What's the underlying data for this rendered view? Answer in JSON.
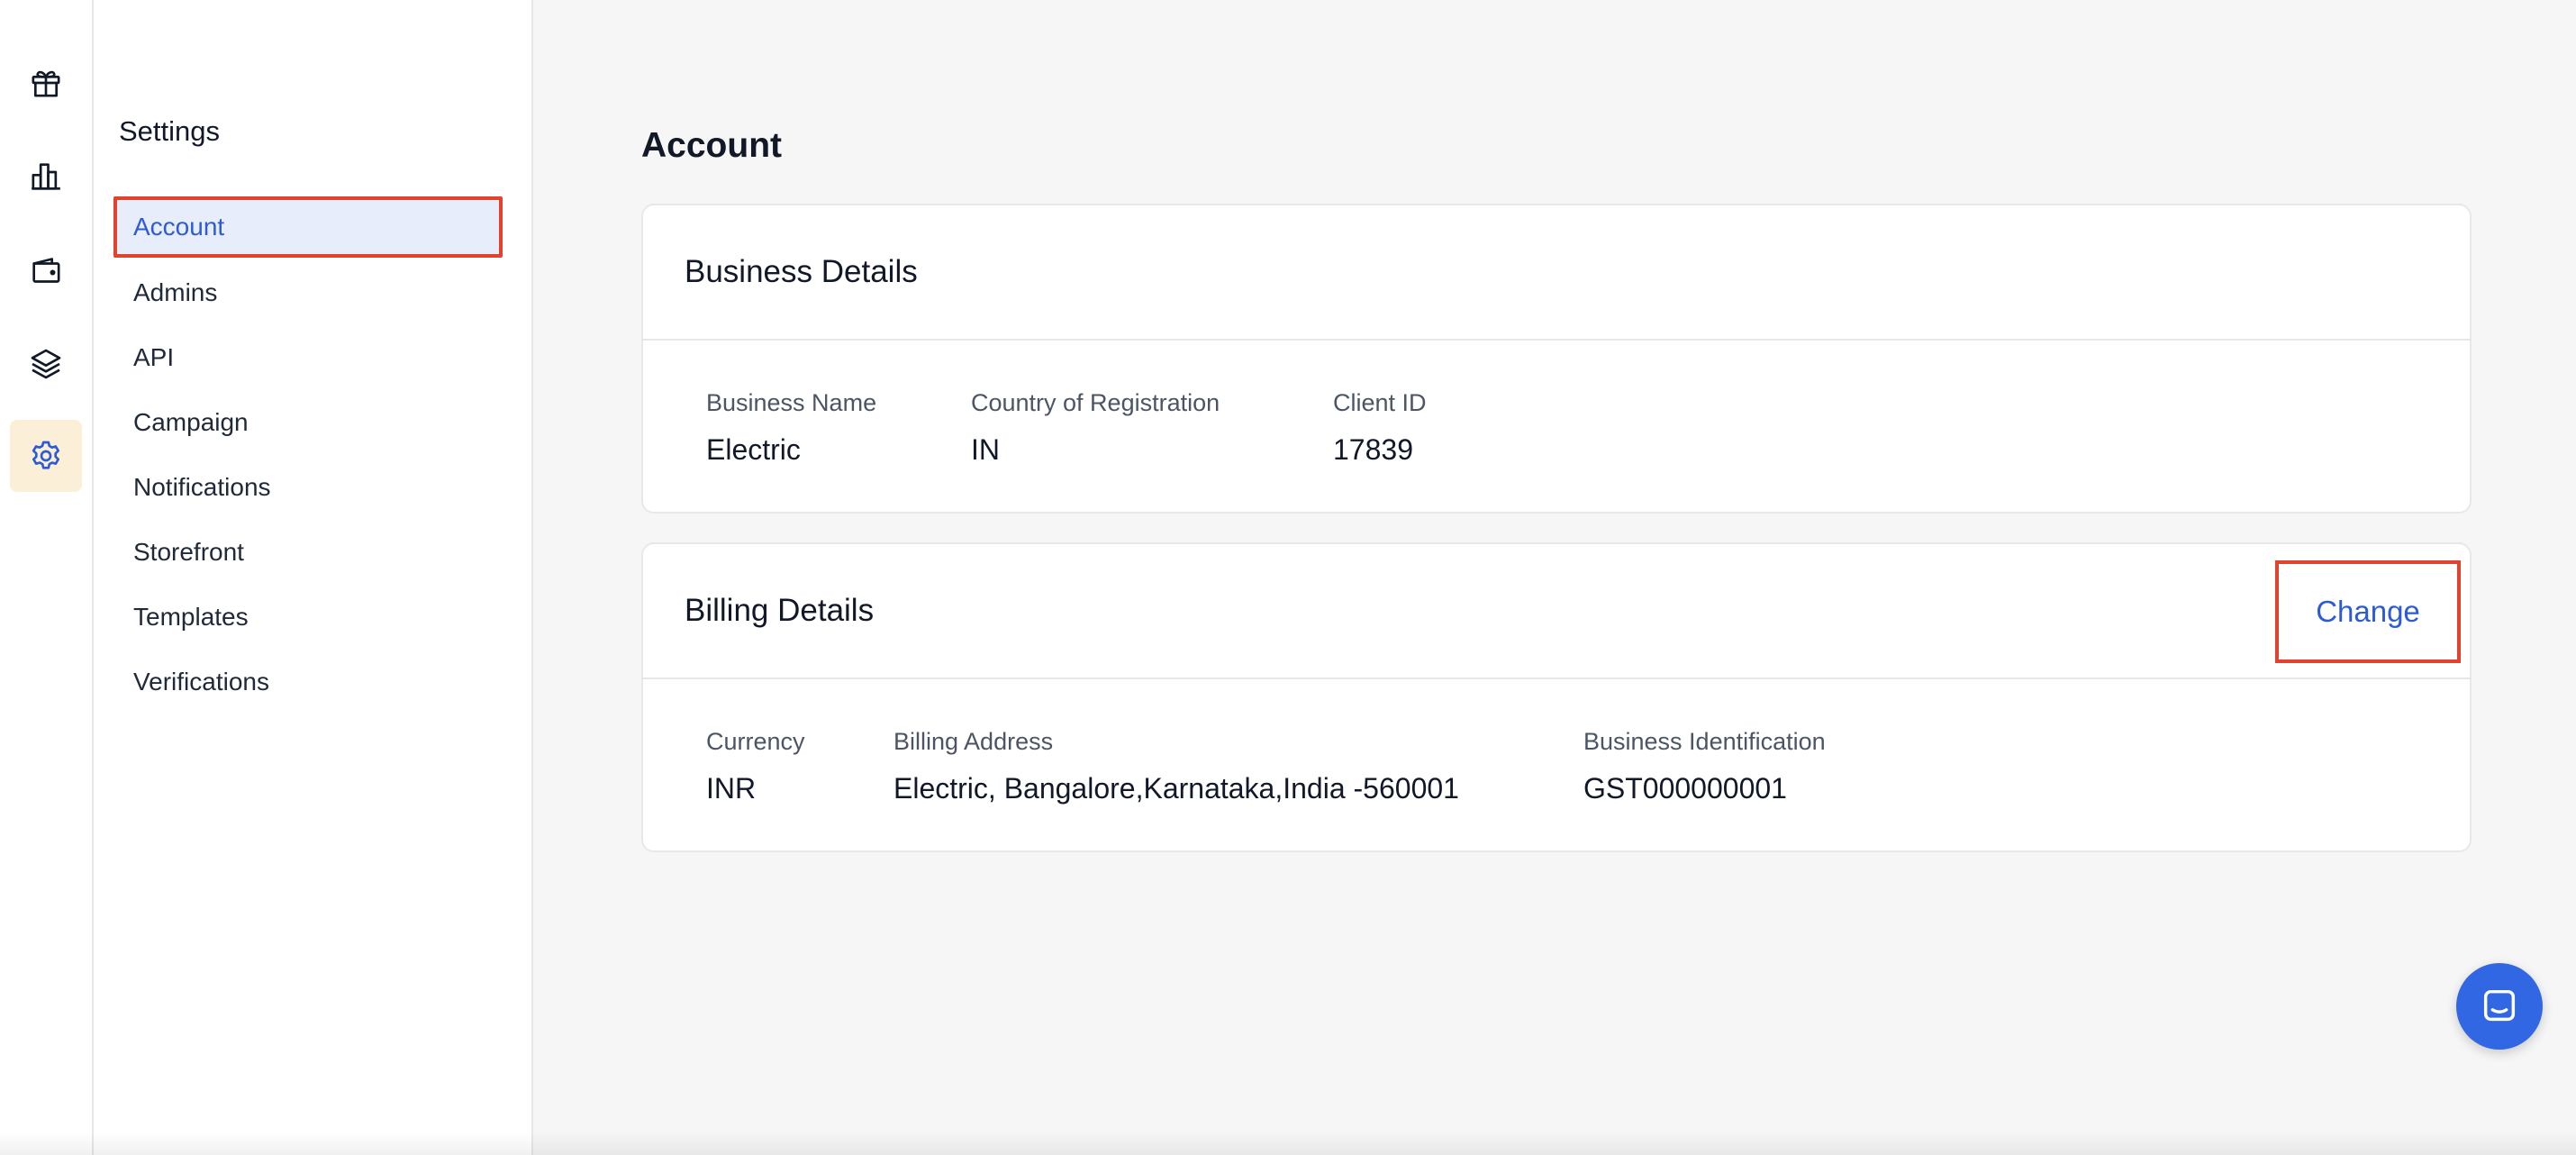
{
  "rail": {
    "items": [
      {
        "icon": "gift-icon",
        "active": false
      },
      {
        "icon": "bar-chart-icon",
        "active": false
      },
      {
        "icon": "wallet-icon",
        "active": false
      },
      {
        "icon": "layers-icon",
        "active": false
      },
      {
        "icon": "gear-icon",
        "active": true
      }
    ]
  },
  "sidebar": {
    "title": "Settings",
    "items": [
      {
        "label": "Account",
        "active": true
      },
      {
        "label": "Admins"
      },
      {
        "label": "API"
      },
      {
        "label": "Campaign"
      },
      {
        "label": "Notifications"
      },
      {
        "label": "Storefront"
      },
      {
        "label": "Templates"
      },
      {
        "label": "Verifications"
      }
    ]
  },
  "main": {
    "page_title": "Account",
    "business": {
      "title": "Business Details",
      "fields": [
        {
          "label": "Business Name",
          "value": "Electric"
        },
        {
          "label": "Country of Registration",
          "value": "IN"
        },
        {
          "label": "Client ID",
          "value": "17839"
        }
      ]
    },
    "billing": {
      "title": "Billing Details",
      "change_label": "Change",
      "fields": [
        {
          "label": "Currency",
          "value": "INR"
        },
        {
          "label": "Billing Address",
          "value": "Electric, Bangalore,Karnataka,India -560001"
        },
        {
          "label": "Business Identification",
          "value": "GST000000001"
        }
      ]
    }
  },
  "colors": {
    "accent": "#2d5bd7",
    "highlight_border": "#e2432f",
    "active_rail_bg": "#fbf0d7",
    "active_nav_bg": "#e8edfb",
    "chat_button": "#3267e3"
  }
}
